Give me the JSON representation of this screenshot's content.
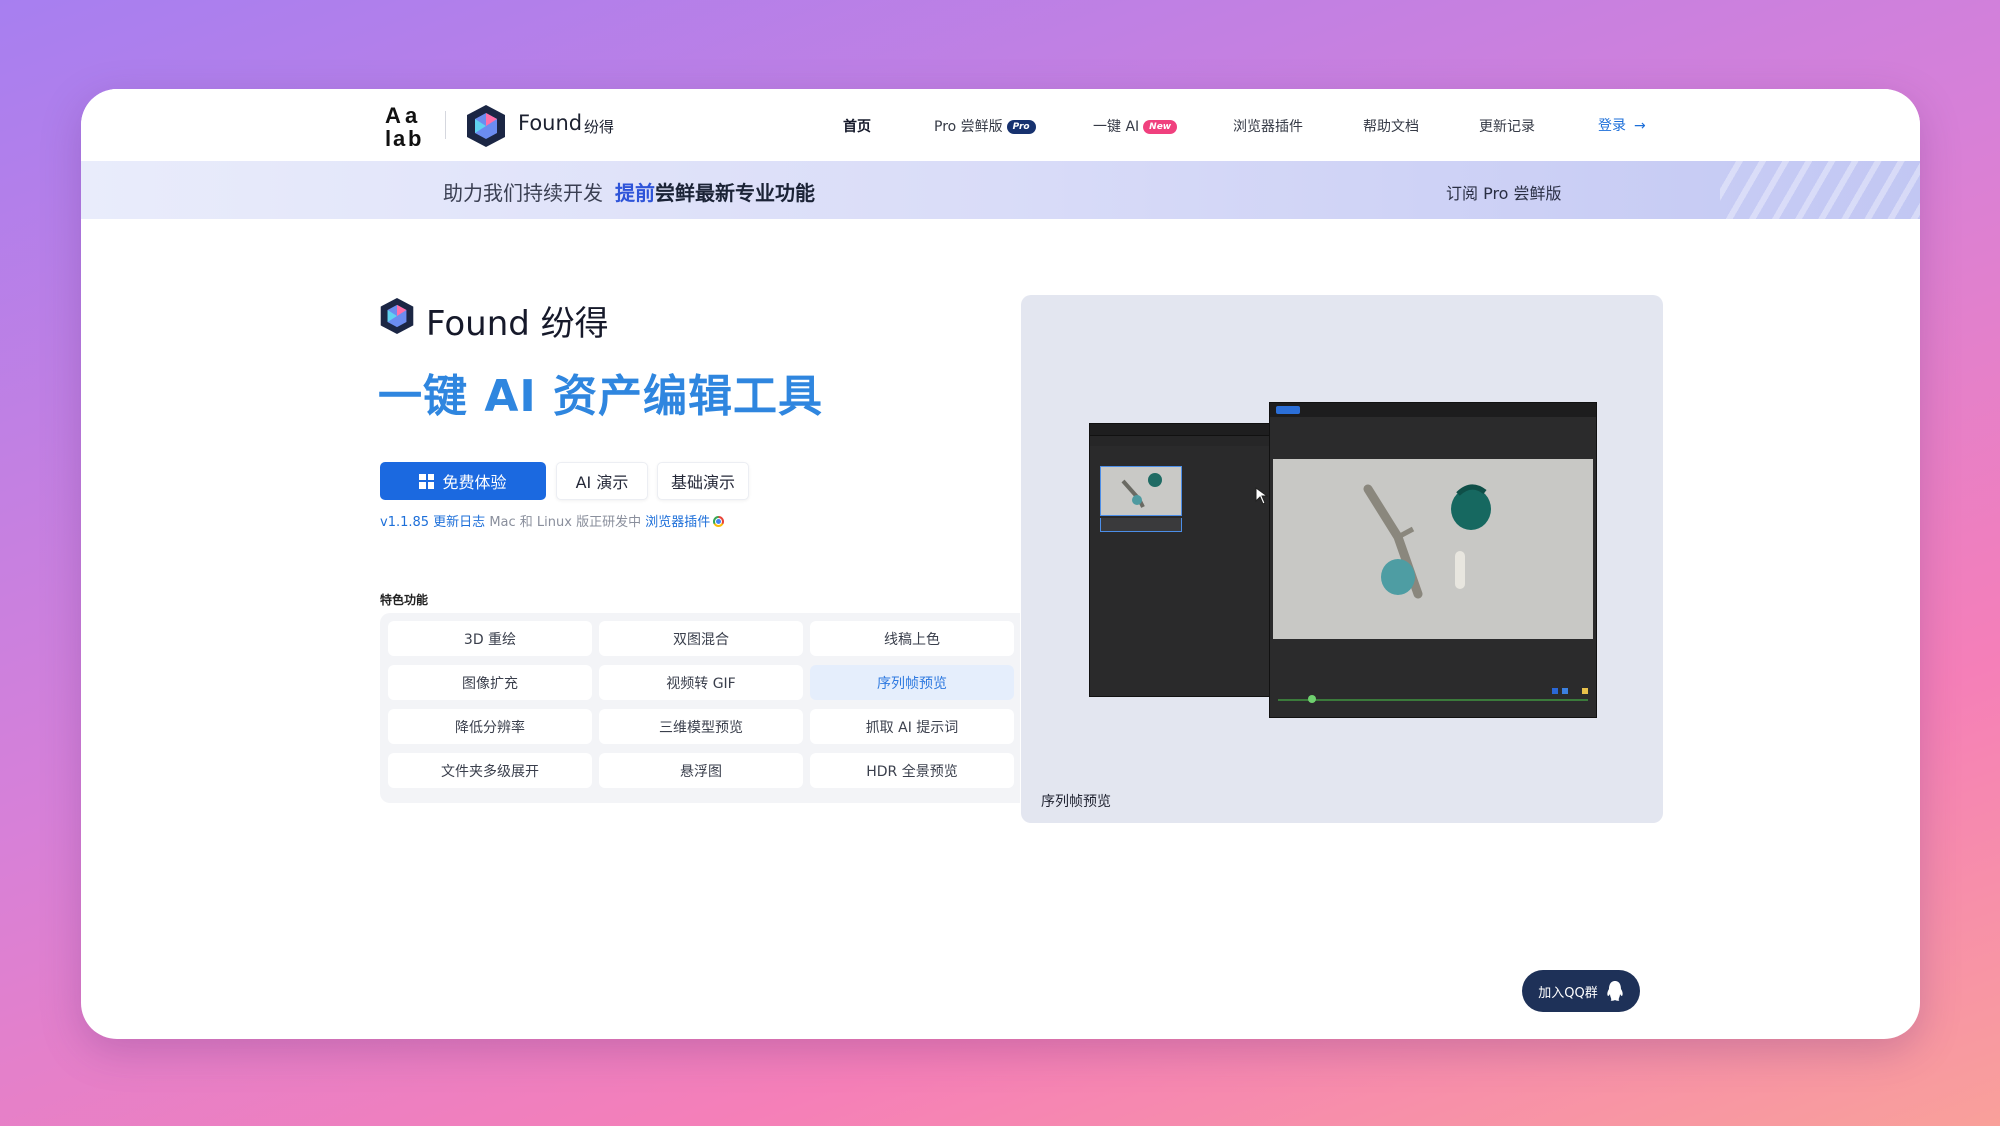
{
  "nav": {
    "brand_name": "Found",
    "brand_cn": "纷得",
    "items": [
      {
        "label": "首页",
        "active": true
      },
      {
        "label": "Pro 尝鲜版",
        "badge": "Pro"
      },
      {
        "label": "一键 AI",
        "badge": "New"
      },
      {
        "label": "浏览器插件"
      },
      {
        "label": "帮助文档"
      },
      {
        "label": "更新记录"
      }
    ],
    "login_label": "登录",
    "login_arrow": "→"
  },
  "promo": {
    "text": "助力我们持续开发",
    "highlight_1": "提前",
    "highlight_2": "尝鲜最新专业功能",
    "cta": "订阅 Pro 尝鲜版"
  },
  "hero": {
    "brand": "Found 纷得",
    "title": "一键 AI 资产编辑工具",
    "primary_button": "免费体验",
    "ai_demo_button": "AI 演示",
    "basic_demo_button": "基础演示",
    "version_link": "v1.1.85 更新日志",
    "platform_note": " Mac 和 Linux 版正研发中 ",
    "plugin_link": "浏览器插件"
  },
  "features": {
    "label": "特色功能",
    "items": [
      {
        "label": "3D 重绘"
      },
      {
        "label": "双图混合"
      },
      {
        "label": "线稿上色"
      },
      {
        "label": "图像扩充"
      },
      {
        "label": "视频转 GIF"
      },
      {
        "label": "序列帧预览",
        "active": true
      },
      {
        "label": "降低分辨率"
      },
      {
        "label": "三维模型预览"
      },
      {
        "label": "抓取 AI 提示词"
      },
      {
        "label": "文件夹多级展开"
      },
      {
        "label": "悬浮图"
      },
      {
        "label": "HDR 全景预览"
      }
    ]
  },
  "preview": {
    "caption": "序列帧预览"
  },
  "qq": {
    "label": "加入QQ群"
  },
  "colors": {
    "primary": "#1b69e0",
    "title_blue": "#2f86df",
    "active_feature_bg": "#e5eefc",
    "qq_bg": "#1e3158",
    "badge_pro": "#17326f",
    "badge_new": "#f0407e"
  }
}
